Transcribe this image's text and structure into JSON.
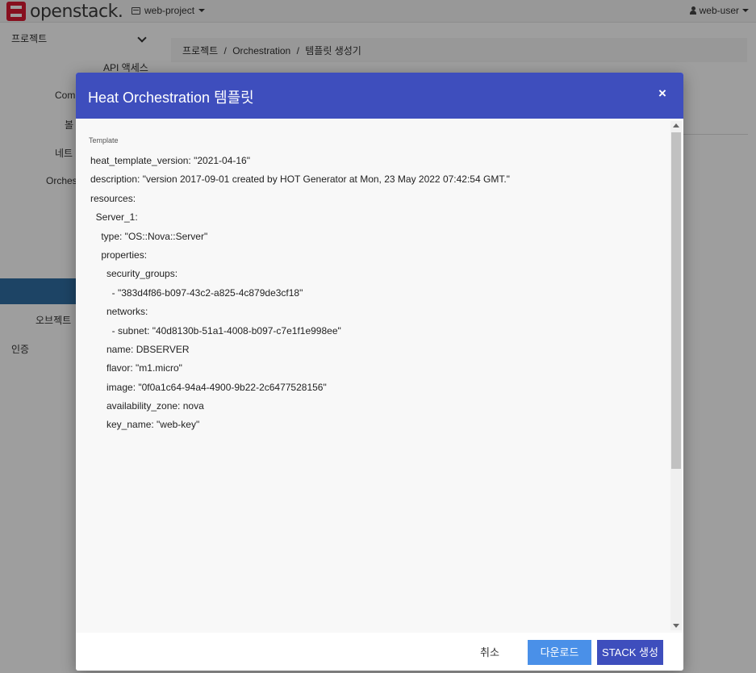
{
  "navbar": {
    "brand": "openstack",
    "brand_dot": ".",
    "project": "web-project",
    "user": "web-user"
  },
  "sidebar": {
    "project_label": "프로젝트",
    "api_access": "API 액세스",
    "compute": "Comp",
    "volume": "볼",
    "network": "네트",
    "orchestration": "Orches",
    "object_store": "오브젝트",
    "identity": "인증"
  },
  "breadcrumb": {
    "items": [
      "프로젝트",
      "/",
      "Orchestration",
      "/",
      "템플릿 생성기"
    ]
  },
  "modal": {
    "title": "Heat Orchestration 템플릿",
    "close": "×",
    "field_label": "Template",
    "lines": [
      "heat_template_version: \"2021-04-16\"",
      "description: \"version 2017-09-01 created by HOT Generator at Mon, 23 May 2022 07:42:54 GMT.\"",
      "resources:",
      "  Server_1:",
      "    type: \"OS::Nova::Server\"",
      "    properties:",
      "      security_groups:",
      "        - \"383d4f86-b097-43c2-a825-4c879de3cf18\"",
      "      networks:",
      "        - subnet: \"40d8130b-51a1-4008-b097-c7e1f1e998ee\"",
      "      name: DBSERVER",
      "      flavor: \"m1.micro\"",
      "      image: \"0f0a1c64-94a4-4900-9b22-2c6477528156\"",
      "      availability_zone: nova",
      "      key_name: \"web-key\""
    ],
    "buttons": {
      "cancel": "취소",
      "download": "다운로드",
      "create": "STACK 생성"
    }
  },
  "colors": {
    "header": "#3e4ebd",
    "download_button": "#4a90e8",
    "create_button": "#3e4ebd",
    "brand_red": "#da1a32",
    "sidebar_active": "#2f6ea3"
  }
}
